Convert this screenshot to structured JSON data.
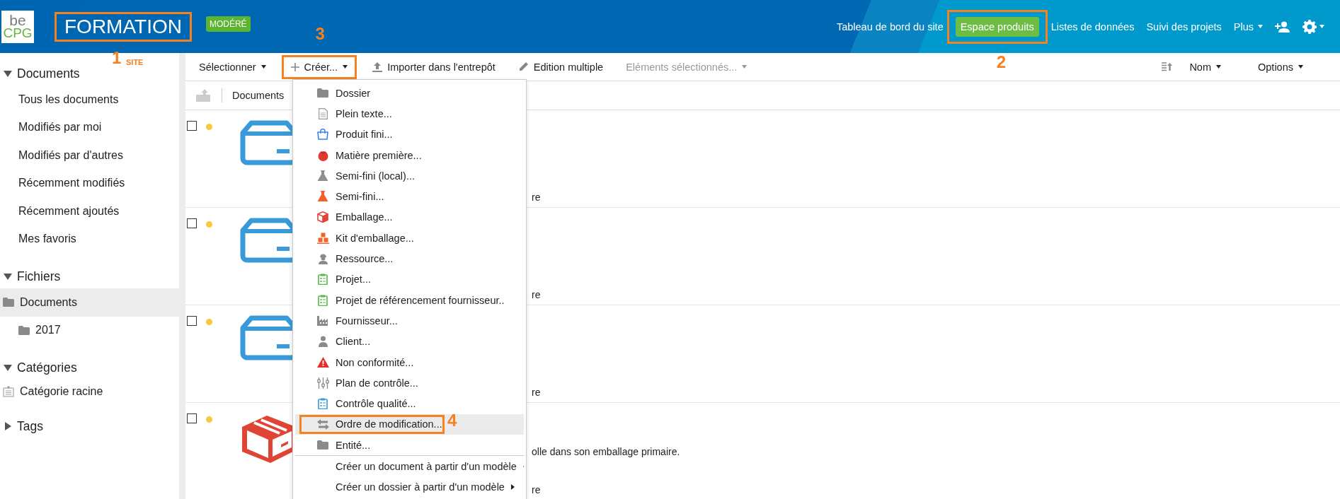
{
  "header": {
    "logo": {
      "top": "be",
      "bottom": "CPG"
    },
    "site_title": {
      "text": "FORMATION",
      "callout": {
        "number": "1",
        "note": "SITE"
      }
    },
    "site_badge": "MODÉRÉ",
    "nav": [
      {
        "label": "Tableau de bord du site",
        "selected": false,
        "dropdown": false
      },
      {
        "label": "Espace produits",
        "selected": true,
        "dropdown": false,
        "callout": {
          "number": "2"
        }
      },
      {
        "label": "Listes de données",
        "selected": false,
        "dropdown": false
      },
      {
        "label": "Suivi des projets",
        "selected": false,
        "dropdown": false
      },
      {
        "label": "Plus",
        "selected": false,
        "dropdown": true
      }
    ]
  },
  "sidebar": {
    "sections": [
      {
        "kind": "links",
        "title": "Documents",
        "expanded": true,
        "items": [
          {
            "label": "Tous les documents",
            "selected": false
          },
          {
            "label": "Modifiés par moi",
            "selected": false
          },
          {
            "label": "Modifiés par d'autres",
            "selected": false
          },
          {
            "label": "Récemment modifiés",
            "selected": false
          },
          {
            "label": "Récemment ajoutés",
            "selected": false
          },
          {
            "label": "Mes favoris",
            "selected": false
          }
        ]
      },
      {
        "kind": "folders",
        "title": "Fichiers",
        "expanded": true,
        "items": [
          {
            "label": "Documents",
            "selected": true,
            "children": [
              {
                "label": "2017",
                "selected": false
              }
            ]
          }
        ]
      },
      {
        "kind": "categories",
        "title": "Catégories",
        "expanded": true,
        "items": [
          {
            "label": "Catégorie racine",
            "selected": false
          }
        ]
      },
      {
        "title": "Tags",
        "expanded": false
      }
    ]
  },
  "toolbar": {
    "left": [
      {
        "label": "Sélectionner",
        "dropdown": true,
        "disabled": false
      },
      {
        "label": "Créer...",
        "dropdown": true,
        "disabled": false,
        "callout": {
          "number": "3"
        }
      },
      {
        "label": "Importer dans l'entrepôt",
        "dropdown": false,
        "disabled": false
      },
      {
        "label": "Edition multiple",
        "dropdown": false,
        "disabled": false
      },
      {
        "label": "Eléments sélectionnés...",
        "dropdown": true,
        "disabled": true
      }
    ],
    "right": [
      {
        "label": "Nom",
        "dropdown": true
      },
      {
        "label": "Options",
        "dropdown": true
      }
    ]
  },
  "breadcrumb": {
    "path": "Documents"
  },
  "rows": [
    {
      "kind": "product",
      "checked": false,
      "color": "#f8c93f",
      "lines": [
        "re"
      ]
    },
    {
      "kind": "product",
      "checked": false,
      "color": "#f8c93f",
      "lines": [
        "re"
      ]
    },
    {
      "kind": "product",
      "checked": false,
      "color": "#f8c93f",
      "lines": [
        "re"
      ]
    },
    {
      "kind": "packaging",
      "checked": false,
      "color": "#f8c93f",
      "lines": [
        "olle dans son emballage primaire.",
        "re"
      ]
    }
  ],
  "create_menu": {
    "items": [
      {
        "kind": "entry",
        "label": "Dossier",
        "hovered": false
      },
      {
        "kind": "entry",
        "label": "Plein texte...",
        "hovered": false
      },
      {
        "kind": "entry",
        "label": "Produit fini...",
        "hovered": false
      },
      {
        "kind": "entry",
        "label": "Matière première...",
        "hovered": false
      },
      {
        "kind": "entry",
        "label": "Semi-fini (local)...",
        "hovered": false
      },
      {
        "kind": "entry",
        "label": "Semi-fini...",
        "hovered": false
      },
      {
        "kind": "entry",
        "label": "Emballage...",
        "hovered": false
      },
      {
        "kind": "entry",
        "label": "Kit d'emballage...",
        "hovered": false
      },
      {
        "kind": "entry",
        "label": "Ressource...",
        "hovered": false
      },
      {
        "kind": "entry",
        "label": "Projet...",
        "hovered": false
      },
      {
        "kind": "entry",
        "label": "Projet de référencement fournisseur..",
        "hovered": false
      },
      {
        "kind": "entry",
        "label": "Fournisseur...",
        "hovered": false
      },
      {
        "kind": "entry",
        "label": "Client...",
        "hovered": false
      },
      {
        "kind": "entry",
        "label": "Non conformité...",
        "hovered": false
      },
      {
        "kind": "entry",
        "label": "Plan de contrôle...",
        "hovered": false
      },
      {
        "kind": "entry",
        "label": "Contrôle qualité...",
        "hovered": false
      },
      {
        "kind": "entry",
        "label": "Ordre de modification...",
        "hovered": true,
        "callout": {
          "number": "4"
        }
      },
      {
        "kind": "entry",
        "label": "Entité...",
        "hovered": false
      },
      {
        "kind": "submenu",
        "label": "Créer un document à partir d'un modèle",
        "hovered": false
      },
      {
        "kind": "submenu",
        "label": "Créer un dossier à partir d'un modèle",
        "hovered": false
      }
    ]
  }
}
